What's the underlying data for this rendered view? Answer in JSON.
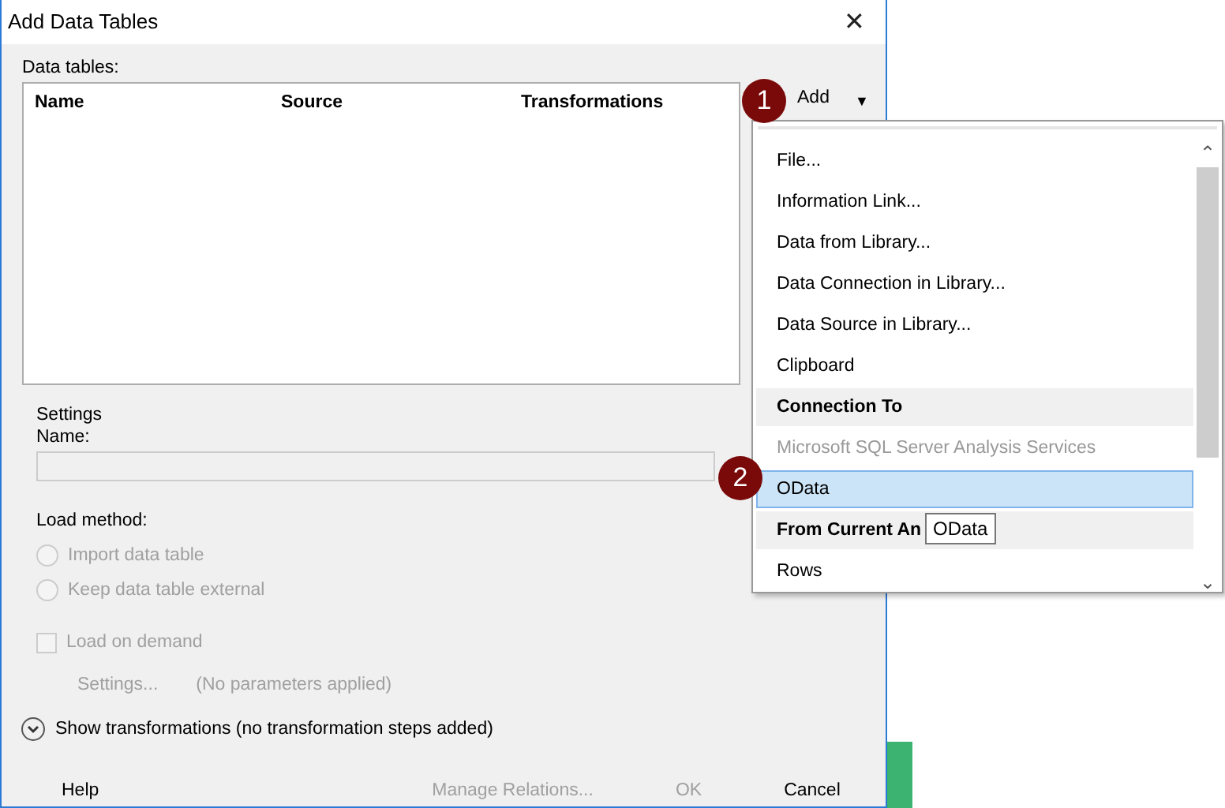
{
  "window": {
    "title": "Add Data Tables",
    "close": "✕"
  },
  "data_tables": {
    "label": "Data tables:",
    "columns": [
      "Name",
      "Source",
      "Transformations"
    ]
  },
  "add_button": {
    "label": "Add",
    "caret": "▼"
  },
  "settings": {
    "heading": "Settings",
    "name_label": "Name:",
    "name_disabled": true,
    "load_method_label": "Load method:",
    "radios": [
      {
        "label": "Import data table",
        "selected": false,
        "disabled": true
      },
      {
        "label": "Keep data table external",
        "selected": false,
        "disabled": true
      }
    ],
    "load_on_demand": {
      "label": "Load on demand",
      "checked": false,
      "disabled": true
    },
    "settings_button": "Settings...",
    "parameters_note": "(No parameters applied)"
  },
  "show_transformations": "Show transformations (no transformation steps added)",
  "buttons": [
    {
      "label": "Help",
      "disabled": false
    },
    {
      "label": "Manage Relations...",
      "disabled": true
    },
    {
      "label": "OK",
      "disabled": true
    },
    {
      "label": "Cancel",
      "disabled": false
    }
  ],
  "dropdown": {
    "items": [
      {
        "kind": "item",
        "label": "File...",
        "disabled": false,
        "selected": false
      },
      {
        "kind": "item",
        "label": "Information Link...",
        "disabled": false,
        "selected": false
      },
      {
        "kind": "item",
        "label": "Data from Library...",
        "disabled": false,
        "selected": false
      },
      {
        "kind": "item",
        "label": "Data Connection in Library...",
        "disabled": false,
        "selected": false
      },
      {
        "kind": "item",
        "label": "Data Source in Library...",
        "disabled": false,
        "selected": false
      },
      {
        "kind": "item",
        "label": "Clipboard",
        "disabled": false,
        "selected": false
      },
      {
        "kind": "header",
        "label": "Connection To",
        "disabled": false,
        "selected": false
      },
      {
        "kind": "item",
        "label": "Microsoft SQL Server Analysis Services",
        "disabled": true,
        "selected": false
      },
      {
        "kind": "item",
        "label": "OData",
        "disabled": false,
        "selected": true
      },
      {
        "kind": "header",
        "label": "From Current An",
        "disabled": false,
        "selected": false
      },
      {
        "kind": "item",
        "label": "Rows",
        "disabled": false,
        "selected": false
      }
    ],
    "scroll_up": "⌃",
    "scroll_down": "⌄"
  },
  "tooltip": "OData",
  "callouts": [
    {
      "number": "1"
    },
    {
      "number": "2"
    }
  ]
}
